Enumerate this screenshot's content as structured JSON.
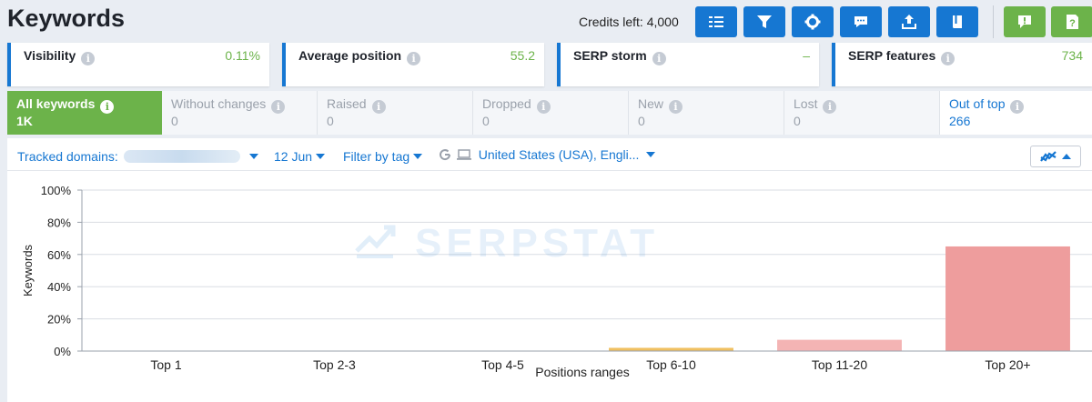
{
  "header": {
    "title": "Keywords",
    "credits": "Credits left: 4,000",
    "toolbar": [
      {
        "icon": "list-icon",
        "color": "#1677d2"
      },
      {
        "icon": "filter-icon",
        "color": "#1677d2"
      },
      {
        "icon": "gear-icon",
        "color": "#1677d2"
      },
      {
        "icon": "comment-icon",
        "color": "#1677d2"
      },
      {
        "icon": "export-icon",
        "color": "#1677d2"
      },
      {
        "icon": "book-icon",
        "color": "#1677d2"
      },
      {
        "icon": "feedback-icon",
        "color": "#6cb34a"
      },
      {
        "icon": "help-icon",
        "color": "#6cb34a"
      }
    ]
  },
  "metrics": [
    {
      "label": "Visibility",
      "value": "0.11%"
    },
    {
      "label": "Average position",
      "value": "55.2"
    },
    {
      "label": "SERP storm",
      "value": "–"
    },
    {
      "label": "SERP features",
      "value": "734"
    }
  ],
  "tabs": [
    {
      "label": "All keywords",
      "count": "1K"
    },
    {
      "label": "Without changes",
      "count": "0"
    },
    {
      "label": "Raised",
      "count": "0"
    },
    {
      "label": "Dropped",
      "count": "0"
    },
    {
      "label": "New",
      "count": "0"
    },
    {
      "label": "Lost",
      "count": "0"
    },
    {
      "label": "Out of top",
      "count": "266"
    }
  ],
  "filters": {
    "tracked_domains": "Tracked domains:",
    "date": "12 Jun",
    "tag": "Filter by tag",
    "region": "United States (USA), Engli..."
  },
  "watermark": "SERPSTAT",
  "chart_data": {
    "type": "bar",
    "categories": [
      "Top 1",
      "Top 2-3",
      "Top 4-5",
      "Top 6-10",
      "Top 11-20",
      "Top 20+"
    ],
    "values": [
      0,
      0,
      0,
      2,
      7,
      65
    ],
    "colors": [
      "#f0c060",
      "#f0c060",
      "#f0c060",
      "#f0c060",
      "#f4b4b4",
      "#ee9d9d"
    ],
    "xlabel": "Positions ranges",
    "ylabel": "Keywords",
    "ylim": [
      0,
      100
    ],
    "yticks": [
      "0%",
      "20%",
      "40%",
      "60%",
      "80%",
      "100%"
    ],
    "grid": true
  }
}
